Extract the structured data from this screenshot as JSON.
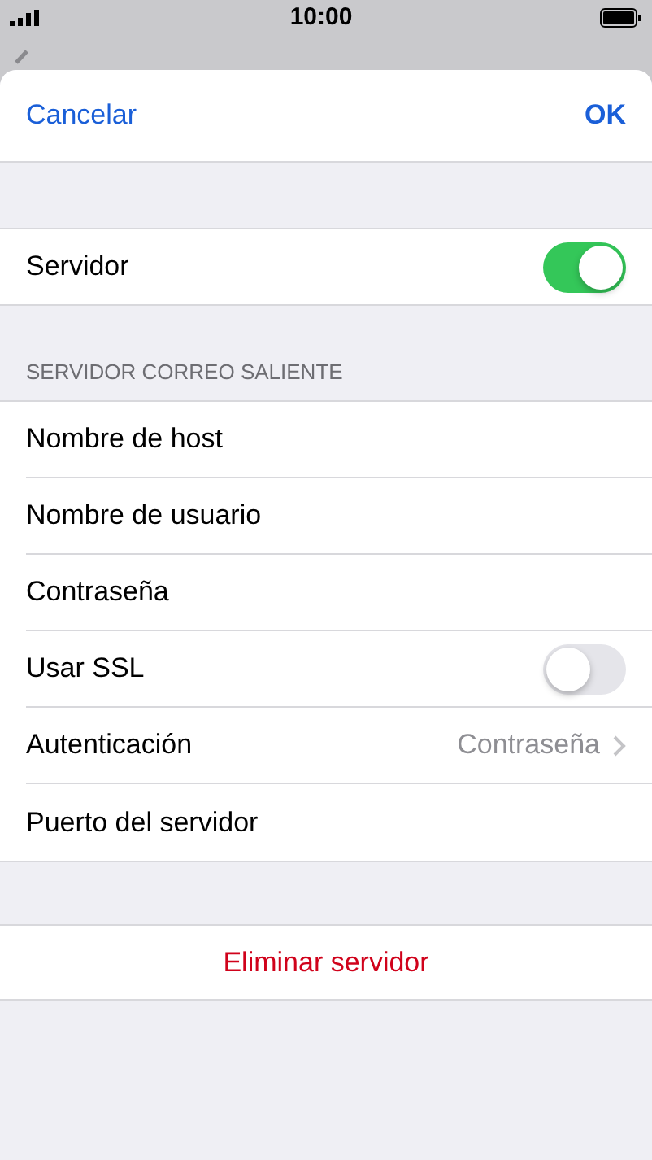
{
  "status_bar": {
    "time": "10:00"
  },
  "sheet_header": {
    "cancel": "Cancelar",
    "ok": "OK"
  },
  "server_row": {
    "label": "Servidor",
    "on": true
  },
  "section": {
    "header": "SERVIDOR CORREO SALIENTE",
    "rows": [
      {
        "kind": "field",
        "label": "Nombre de host"
      },
      {
        "kind": "field",
        "label": "Nombre de usuario"
      },
      {
        "kind": "field",
        "label": "Contraseña"
      },
      {
        "kind": "toggle",
        "label": "Usar SSL",
        "on": false
      },
      {
        "kind": "value",
        "label": "Autenticación",
        "value": "Contraseña"
      },
      {
        "kind": "field",
        "label": "Puerto del servidor"
      }
    ]
  },
  "delete_button": "Eliminar servidor"
}
